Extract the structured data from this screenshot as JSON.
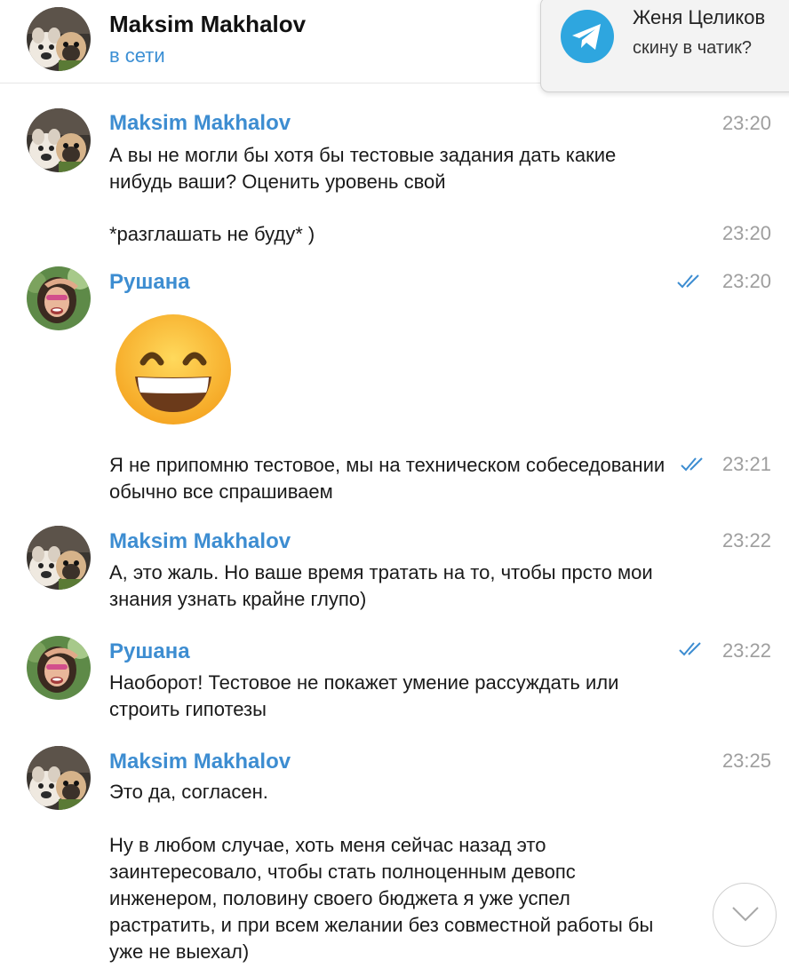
{
  "header": {
    "chat_name": "Maksim Makhalov",
    "status": "в сети"
  },
  "notification": {
    "icon": "telegram-icon",
    "title": "Женя Целиков",
    "body": "скину в чатик?"
  },
  "colors": {
    "accent": "#3d8dd1",
    "time": "#9e9e9e",
    "telegram": "#2ea6df"
  },
  "messages": [
    {
      "sender": "Maksim Makhalov",
      "time": "23:20",
      "text": "А вы не могли бы хотя бы тестовые задания дать какие нибудь ваши? Оценить уровень свой"
    },
    {
      "time": "23:20",
      "text": "*разглашать не буду* )"
    },
    {
      "sender": "Рушана",
      "time": "23:20",
      "read": true,
      "emoji": "grinning-face"
    },
    {
      "time": "23:21",
      "read": true,
      "text": "Я не припомню тестовое, мы на техническом собеседовании обычно все спрашиваем"
    },
    {
      "sender": "Maksim Makhalov",
      "time": "23:22",
      "text": "А, это жаль. Но ваше время тратать на то, чтобы прсто мои знания узнать крайне глупо)"
    },
    {
      "sender": "Рушана",
      "time": "23:22",
      "read": true,
      "text": "Наоборот! Тестовое не покажет умение рассуждать или строить гипотезы"
    },
    {
      "sender": "Maksim Makhalov",
      "time": "23:25",
      "text": "Это да, согласен.\n\nНу в любом случае, хоть меня сейчас назад это заинтересовало, чтобы стать полноценным девопс инженером, половину своего бюджета я уже успел растратить, и при всем желании без совместной работы бы уже не выехал)"
    }
  ]
}
